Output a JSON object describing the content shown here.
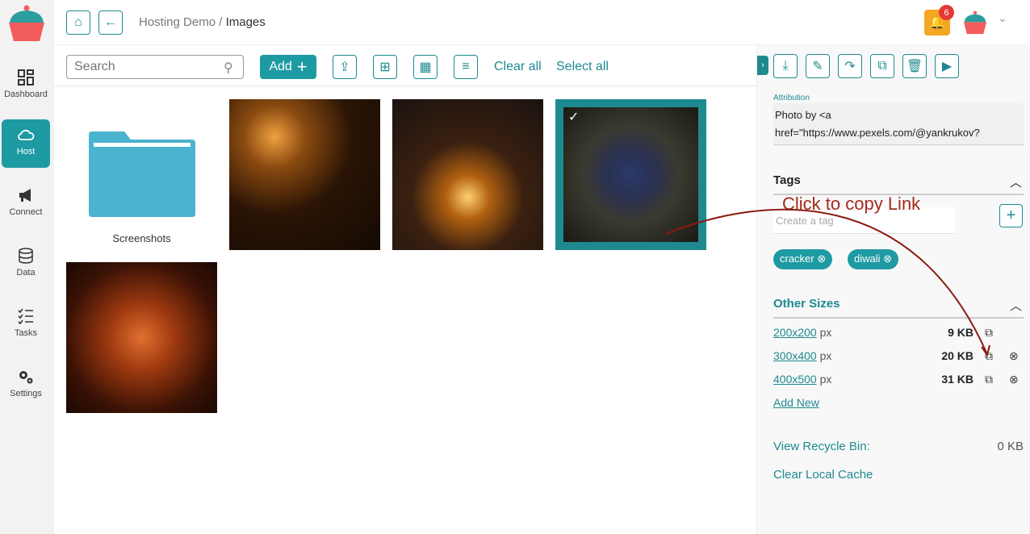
{
  "sidebar": {
    "items": [
      {
        "label": "Dashboard",
        "icon": "dashboard-icon"
      },
      {
        "label": "Host",
        "icon": "cloud-icon",
        "active": true
      },
      {
        "label": "Connect",
        "icon": "megaphone-icon"
      },
      {
        "label": "Data",
        "icon": "database-icon"
      },
      {
        "label": "Tasks",
        "icon": "checklist-icon"
      },
      {
        "label": "Settings",
        "icon": "gear-icon"
      }
    ]
  },
  "header": {
    "breadcrumb_parent": "Hosting Demo",
    "breadcrumb_sep": "/",
    "breadcrumb_current": "Images",
    "notifications": "6"
  },
  "toolbar": {
    "search_placeholder": "Search",
    "add_label": "Add",
    "clear_all": "Clear all",
    "select_all": "Select all"
  },
  "grid": {
    "folder": "Screenshots",
    "selected_index": 2
  },
  "panel": {
    "attribution_label": "Attribution",
    "attribution_value": "Photo by <a href=\"https://www.pexels.com/@yankrukov?",
    "tags_title": "Tags",
    "tag_placeholder": "Create a tag",
    "tags": [
      "cracker",
      "diwali"
    ],
    "other_sizes_title": "Other Sizes",
    "sizes": [
      {
        "dim": "200x200",
        "unit": "px",
        "size": "9 KB"
      },
      {
        "dim": "300x400",
        "unit": "px",
        "size": "20 KB"
      },
      {
        "dim": "400x500",
        "unit": "px",
        "size": "31 KB"
      }
    ],
    "add_new": "Add New",
    "recycle_label": "View Recycle Bin:",
    "recycle_value": "0 KB",
    "clear_cache": "Clear Local Cache"
  },
  "annotation": "Click to copy Link",
  "colors": {
    "accent": "#1e9aa3",
    "bell": "#f5a623",
    "annotation": "#a52a1e"
  }
}
